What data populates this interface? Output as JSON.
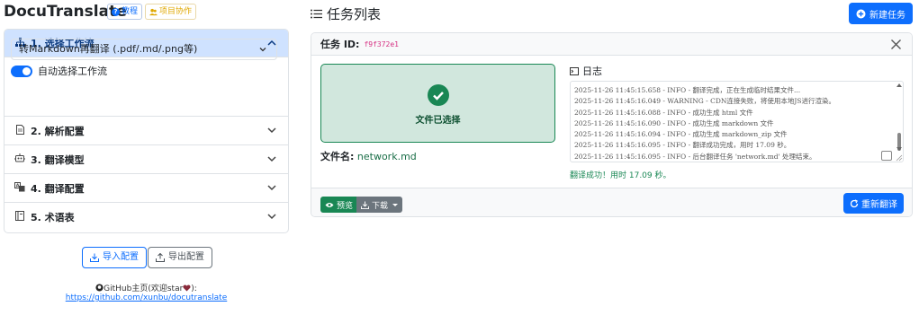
{
  "header": {
    "app_title": "DocuTranslate",
    "tutorial_label": "教程",
    "collab_label": "项目协作"
  },
  "sidebar": {
    "sections": [
      {
        "label": "1. 选择工作流",
        "icon": "sitemap-icon",
        "expanded": true
      },
      {
        "label": "2. 解析配置",
        "icon": "file-icon",
        "expanded": false
      },
      {
        "label": "3. 翻译模型",
        "icon": "robot-icon",
        "expanded": false
      },
      {
        "label": "4. 翻译配置",
        "icon": "translate-icon",
        "expanded": false
      },
      {
        "label": "5. 术语表",
        "icon": "book-icon",
        "expanded": false
      }
    ],
    "workflow_select_value": "转Markdown再翻译 (.pdf/.md/.png等)",
    "auto_select_label": "自动选择工作流",
    "auto_select_on": true,
    "import_label": "导入配置",
    "export_label": "导出配置",
    "github_home": "GitHub主页(欢迎star",
    "github_home_suffix": "):",
    "github_url": "https://github.com/xunbu/docutranslate"
  },
  "main": {
    "title": "任务列表",
    "new_task_label": "新建任务",
    "task": {
      "id_label": "任务 ID:",
      "id_value": "f9f372e1",
      "file_selected_label": "文件已选择",
      "file_name_label": "文件名:",
      "file_name_value": "network.md",
      "log_label": "日志",
      "log_lines": [
        "2025-11-26 11:45:15.658 - INFO - 翻译完成，正在生成临时结果文件...",
        "2025-11-26 11:45:16.049 - WARNING - CDN连接失败，将使用本地JS进行渲染。",
        "2025-11-26 11:45:16.088 - INFO - 成功生成 html 文件",
        "2025-11-26 11:45:16.090 - INFO - 成功生成 markdown 文件",
        "2025-11-26 11:45:16.094 - INFO - 成功生成 markdown_zip 文件",
        "2025-11-26 11:45:16.095 - INFO - 翻译成功完成，用时 17.09 秒。",
        "2025-11-26 11:45:16.095 - INFO - 后台翻译任务 'network.md' 处理结束。"
      ],
      "success_message": "翻译成功！用时 17.09 秒。",
      "preview_label": "预览",
      "download_label": "下载",
      "retranslate_label": "重新翻译"
    }
  },
  "colors": {
    "primary": "#0d6efd",
    "success": "#198754",
    "success_bg": "#d1e7dd",
    "active_section_bg": "#cfe2ff",
    "secondary": "#6c757d",
    "task_id": "#d63384"
  }
}
